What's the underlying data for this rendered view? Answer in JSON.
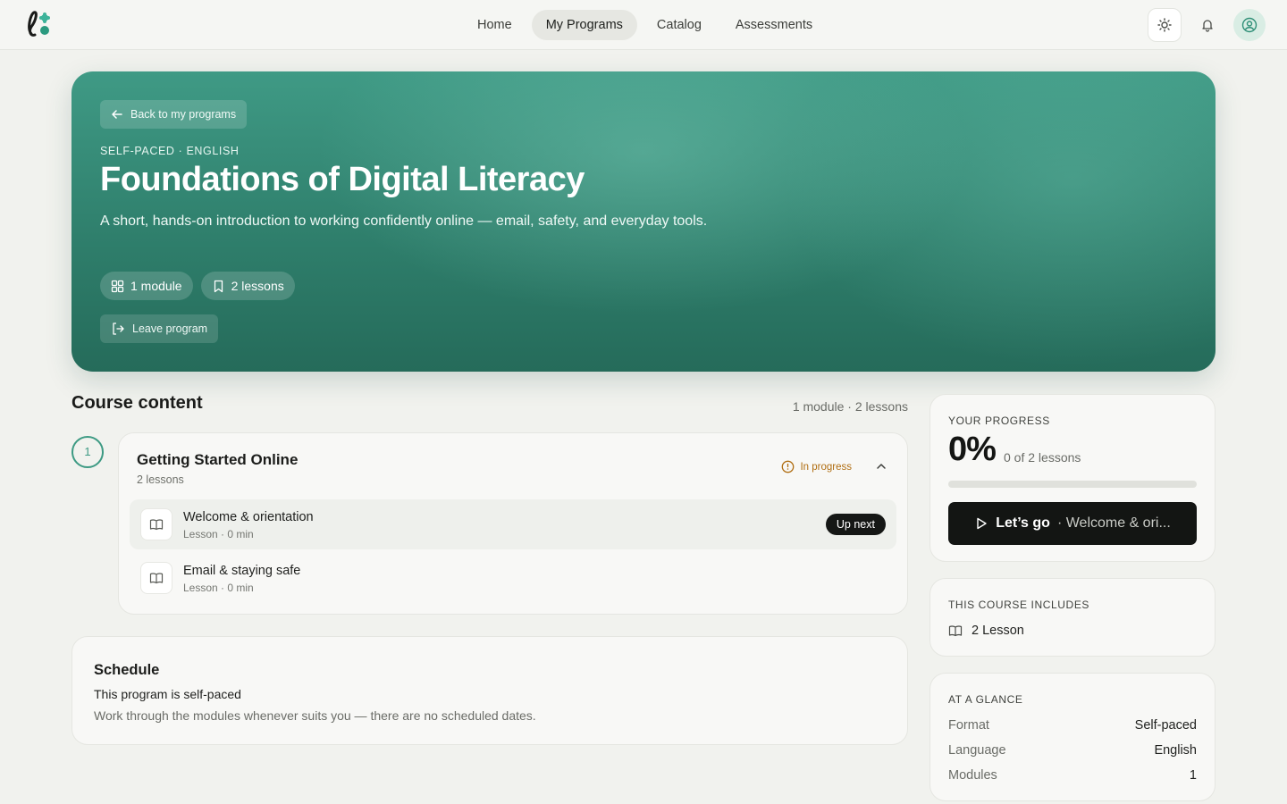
{
  "nav": {
    "items": [
      {
        "label": "Home",
        "active": false
      },
      {
        "label": "My Programs",
        "active": true
      },
      {
        "label": "Catalog",
        "active": false
      },
      {
        "label": "Assessments",
        "active": false
      }
    ]
  },
  "hero": {
    "back_label": "Back to my programs",
    "kicker": "SELF-PACED · ENGLISH",
    "title": "Foundations of Digital Literacy",
    "description": "A short, hands-on introduction to working confidently online — email, safety, and everyday tools.",
    "chips": {
      "modules": "1 module",
      "lessons": "2 lessons"
    },
    "leave_label": "Leave program"
  },
  "course": {
    "title": "Course content",
    "meta": "1 module · 2 lessons",
    "module": {
      "number": "1",
      "title": "Getting Started Online",
      "subtitle": "2 lessons",
      "status": "In progress",
      "lessons": [
        {
          "title": "Welcome & orientation",
          "meta": "Lesson · 0 min",
          "badge": "Up next"
        },
        {
          "title": "Email & staying safe",
          "meta": "Lesson · 0 min",
          "badge": ""
        }
      ]
    }
  },
  "schedule": {
    "title": "Schedule",
    "line1": "This program is self-paced",
    "line2": "Work through the modules whenever suits you — there are no scheduled dates."
  },
  "progress": {
    "label": "YOUR PROGRESS",
    "percent_text": "0%",
    "percent": 0,
    "detail": "0 of 2 lessons",
    "cta_strong": "Let’s go",
    "cta_rest": "· Welcome & ori..."
  },
  "includes": {
    "label": "THIS COURSE INCLUDES",
    "item": "2 Lesson"
  },
  "glance": {
    "label": "AT A GLANCE",
    "rows": [
      {
        "key": "Format",
        "value": "Self-paced"
      },
      {
        "key": "Language",
        "value": "English"
      },
      {
        "key": "Modules",
        "value": "1"
      }
    ]
  },
  "colors": {
    "accent": "#3d9a83",
    "hero_dark": "#256b5a",
    "status": "#b06e12",
    "cta": "#131513"
  }
}
